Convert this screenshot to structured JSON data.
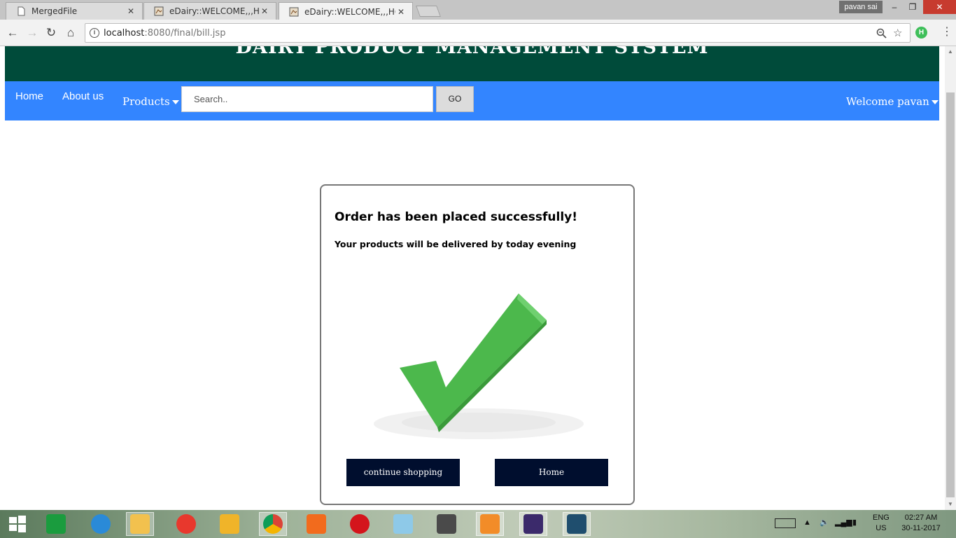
{
  "browser": {
    "tabs": [
      {
        "title": "MergedFile",
        "close": "✕",
        "active": false
      },
      {
        "title": "eDairy::WELCOME,,,HOM",
        "close": "✕",
        "active": false
      },
      {
        "title": "eDairy::WELCOME,,,HOM",
        "close": "✕",
        "active": true
      }
    ],
    "profile_name": "pavan sai",
    "window_controls": {
      "minimize": "–",
      "restore": "❐",
      "close": "✕"
    },
    "url_host": "localhost",
    "url_rest": ":8080/final/bill.jsp",
    "extension_label": "H"
  },
  "site": {
    "header_title": "DAIRY PRODUCT MANAGEMENT SYSTEM",
    "nav": {
      "home": "Home",
      "about": "About us",
      "products": "Products",
      "search_placeholder": "Search..",
      "go": "GO",
      "welcome": "Welcome pavan"
    }
  },
  "order": {
    "heading": "Order has been placed successfully!",
    "message": "Your products will be delivered by today evening",
    "continue_button": "continue shopping",
    "home_button": "Home",
    "check_color": "#4cb84c"
  },
  "taskbar": {
    "apps": [
      "windows-start",
      "store",
      "internet-explorer",
      "file-explorer",
      "recorder",
      "winamp",
      "chrome",
      "mi-pc-suite",
      "opera",
      "photos",
      "sublime-text",
      "media-player",
      "java-ee-ide",
      "mysql-workbench"
    ],
    "lang_top": "ENG",
    "lang_bottom": "US",
    "time": "02:27 AM",
    "date": "30-11-2017"
  }
}
